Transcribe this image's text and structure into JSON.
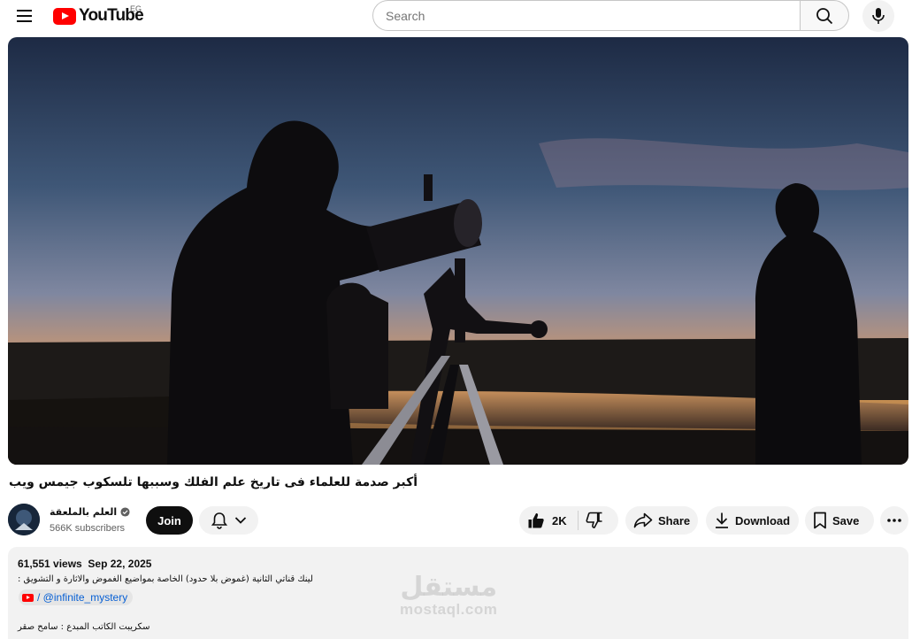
{
  "header": {
    "logo_text": "YouTube",
    "country_code": "EG",
    "search": {
      "placeholder": "Search",
      "value": ""
    },
    "icons": [
      "hamburger-menu-icon",
      "search-icon",
      "microphone-icon"
    ]
  },
  "video": {
    "title": "أكبر صدمة للعلماء فى تاريخ علم الفلك وسببها تلسكوب جيمس ويب",
    "scene": "silhouettes-with-telescope-at-dusk"
  },
  "channel": {
    "name": "العلم بالملعقة",
    "verified_icon": "verified-check-icon",
    "subscribers": "566K subscribers",
    "join_label": "Join",
    "bell_icon": "bell-icon",
    "chevron_icon": "chevron-down-icon"
  },
  "actions": {
    "like_count": "2K",
    "share_label": "Share",
    "download_label": "Download",
    "save_label": "Save",
    "icons": [
      "thumbs-up-icon",
      "thumbs-down-icon",
      "share-icon",
      "download-icon",
      "save-icon",
      "more-icon"
    ]
  },
  "description": {
    "views": "61,551 views",
    "date": "Sep 22, 2025",
    "line1": "لينك قناتي الثانية (غموض بلا حدود) الخاصة بمواضيع الغموض والاثارة و التشويق :",
    "link_text": "/ @infinite_mystery",
    "line3": "سكريبت الكاتب المبدع : سامح صقر"
  },
  "watermark": {
    "arabic": "مستقل",
    "latin": "mostaql.com"
  },
  "colors": {
    "brand_red": "#ff0000",
    "link_blue": "#065fd4",
    "pill_bg": "#f2f2f2",
    "join_bg": "#0f0f0f"
  }
}
